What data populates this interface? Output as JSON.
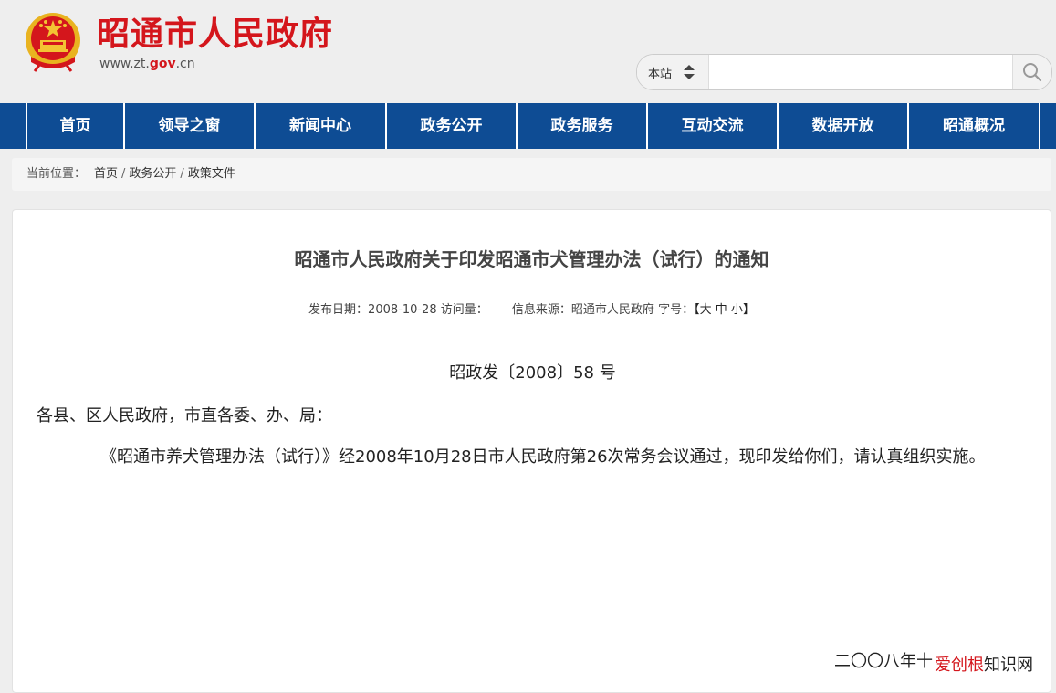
{
  "header": {
    "site_title": "昭通市人民政府",
    "url_prefix": "www.zt.",
    "url_gov": "gov",
    "url_suffix": ".cn",
    "emblem_icon": "national-emblem-icon"
  },
  "search": {
    "scope": "本站",
    "placeholder": "",
    "button_icon": "search-icon"
  },
  "nav": {
    "items": [
      {
        "label": "首页"
      },
      {
        "label": "领导之窗"
      },
      {
        "label": "新闻中心"
      },
      {
        "label": "政务公开"
      },
      {
        "label": "政务服务"
      },
      {
        "label": "互动交流"
      },
      {
        "label": "数据开放"
      },
      {
        "label": "昭通概况"
      }
    ]
  },
  "breadcrumb": {
    "label": "当前位置：",
    "items": [
      "首页",
      "政务公开",
      "政策文件"
    ],
    "separator": "/"
  },
  "article": {
    "title": "昭通市人民政府关于印发昭通市犬管理办法（试行）的通知",
    "publish_label": "发布日期：",
    "publish_date": "2008-10-28",
    "visits_label": "访问量：",
    "source_label": "信息来源：",
    "source": "昭通市人民政府",
    "fontsize_label": "字号：",
    "fontsize_open": "【",
    "fontsize_large": "大",
    "fontsize_medium": "中",
    "fontsize_small": "小",
    "fontsize_close": "】",
    "doc_number": "昭政发〔2008〕58 号",
    "addressee": "各县、区人民政府，市直各委、办、局：",
    "body": "《昭通市养犬管理办法（试行）》经2008年10月28日市人民政府第26次常务会议通过，现印发给你们，请认真组织实施。",
    "date_sign": "二〇〇八年十"
  },
  "watermark": {
    "red": "爱创根",
    "black": "知识网"
  },
  "colors": {
    "brand_red": "#d4161c",
    "nav_blue": "#0e4c94",
    "page_bg": "#eeeeee"
  }
}
